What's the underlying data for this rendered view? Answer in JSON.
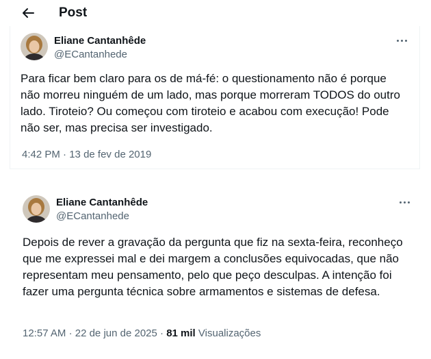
{
  "header": {
    "title": "Post"
  },
  "tweets": [
    {
      "name": "Eliane Cantanhêde",
      "handle": "@ECantanhede",
      "text": "Para ficar bem claro para os de má-fé: o questionamento não é porque não morreu ninguém de um lado, mas porque morreram TODOS do outro lado. Tiroteio? Ou começou com tiroteio e acabou com execução! Pode não ser, mas precisa ser investigado.",
      "time": "4:42 PM",
      "date": "13 de fev de 2019"
    },
    {
      "name": "Eliane Cantanhêde",
      "handle": "@ECantanhede",
      "text": "Depois de rever a gravação da pergunta que fiz na sexta-feira, reconheço que me expressei mal e dei margem a conclusões equivocadas, que não representam meu pensamento, pelo que peço desculpas. A intenção foi fazer uma pergunta técnica sobre armamentos e sistemas de defesa.",
      "time": "12:57 AM",
      "date": "22 de jun de 2025",
      "views_count": "81 mil",
      "views_label": "Visualizações"
    }
  ],
  "separator": "·",
  "icons": {
    "back": "arrow-left-icon",
    "more": "more-horizontal-icon"
  },
  "colors": {
    "text": "#0f1419",
    "secondary": "#536471",
    "border": "#eff3f4"
  }
}
